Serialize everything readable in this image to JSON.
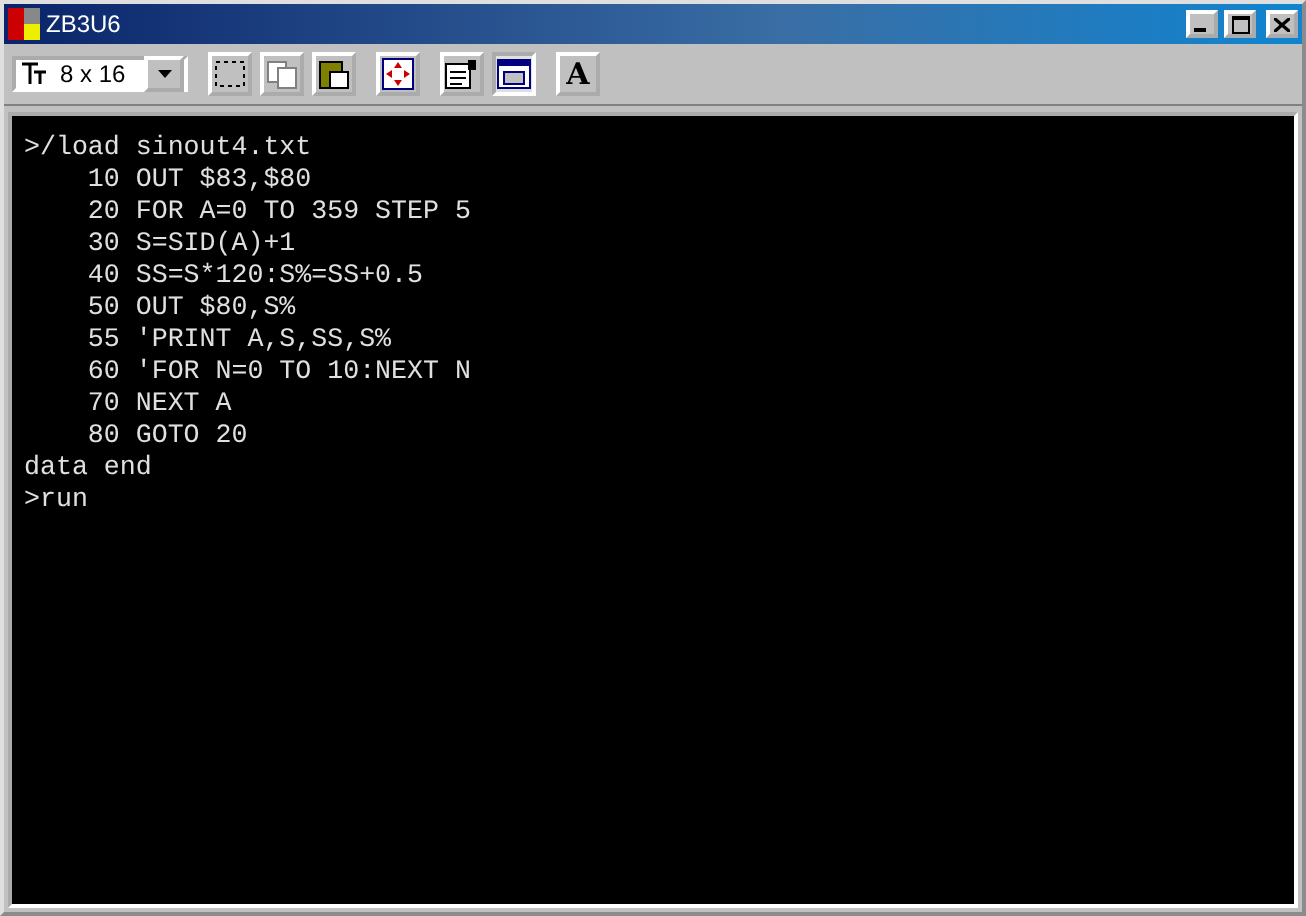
{
  "window": {
    "title": "ZB3U6"
  },
  "toolbar": {
    "font_size": "8 x 16",
    "buttons": [
      {
        "kind": "select",
        "pressed": false
      },
      {
        "kind": "copy",
        "pressed": false
      },
      {
        "kind": "paste",
        "pressed": false
      },
      {
        "kind": "fullscreen",
        "pressed": false
      },
      {
        "kind": "properties",
        "pressed": false
      },
      {
        "kind": "window",
        "pressed": true
      },
      {
        "kind": "font",
        "label": "A",
        "pressed": false
      }
    ]
  },
  "terminal": {
    "lines": [
      ">/load sinout4.txt",
      "    10 OUT $83,$80",
      "    20 FOR A=0 TO 359 STEP 5",
      "    30 S=SID(A)+1",
      "    40 SS=S*120:S%=SS+0.5",
      "    50 OUT $80,S%",
      "    55 'PRINT A,S,SS,S%",
      "    60 'FOR N=0 TO 10:NEXT N",
      "    70 NEXT A",
      "    80 GOTO 20",
      "data end",
      ">run"
    ]
  }
}
